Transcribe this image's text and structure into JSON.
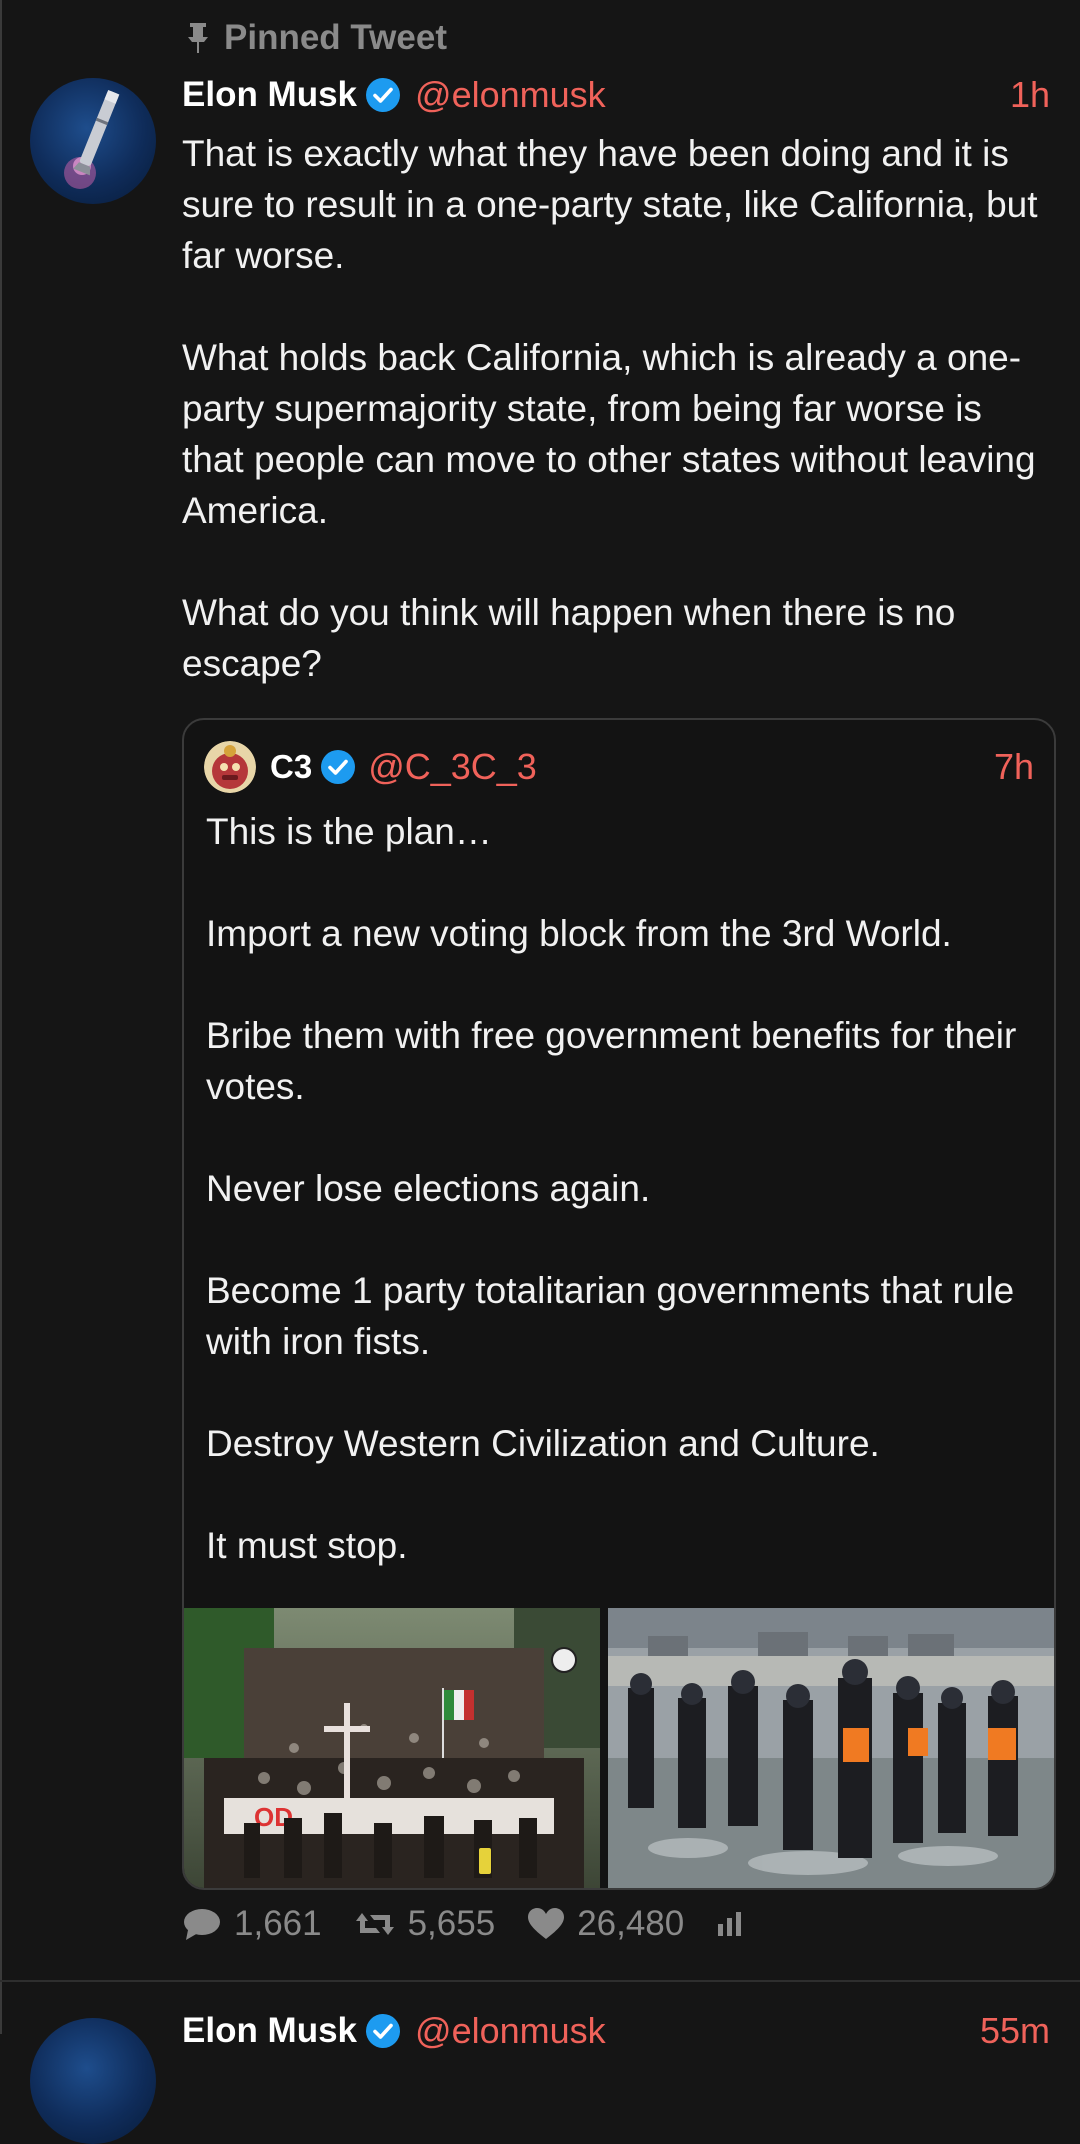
{
  "pinned": {
    "label": "Pinned Tweet",
    "icon": "pin-icon"
  },
  "tweet": {
    "author": "Elon Musk",
    "handle": "@elonmusk",
    "time": "1h",
    "verified": true,
    "paragraphs": [
      "That is exactly what they have been doing and it is sure to result in a one-party state, like California, but far worse.",
      "What holds back California, which is already a one-party supermajority state, from being far worse is that people can move to other states without leaving America.",
      "What do you think will happen when there is no escape?"
    ]
  },
  "quote": {
    "author": "C3",
    "handle": "@C_3C_3",
    "time": "7h",
    "verified": true,
    "paragraphs": [
      "This is the plan…",
      "Import a new voting block from the 3rd World.",
      "Bribe them with free government benefits for their votes.",
      "Never lose elections again.",
      "Become 1 party totalitarian governments that rule with iron fists.",
      "Destroy Western Civilization and Culture.",
      "It must stop."
    ]
  },
  "actions": {
    "replies": "1,661",
    "retweets": "5,655",
    "likes": "26,480"
  },
  "next_tweet": {
    "author": "Elon Musk",
    "handle": "@elonmusk",
    "time": "55m"
  },
  "colors": {
    "background": "#151515",
    "accent": "#f0625a",
    "verified": "#1d9bf0",
    "muted": "#8a8a8a"
  }
}
